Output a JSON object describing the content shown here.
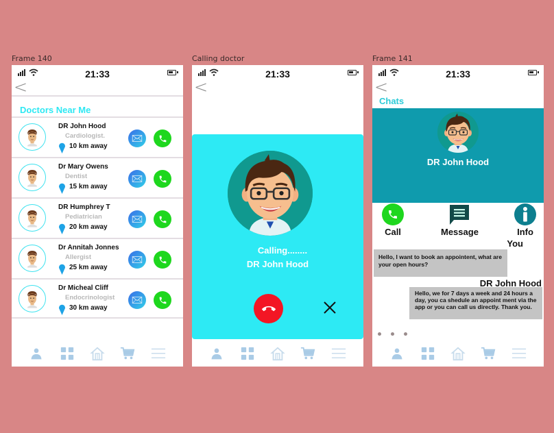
{
  "status_bar": {
    "time": "21:33"
  },
  "colors": {
    "background": "#d88686",
    "accent_cyan": "#2ee8f3",
    "call_green": "#1ed71e",
    "hangup_red": "#f31624",
    "chat_header_teal": "#0f9bad",
    "nav_icon_blue": "#a9cbe6"
  },
  "frames": [
    {
      "label": "Frame 140",
      "title": "Doctors Near Me",
      "doctors": [
        {
          "name": "DR John Hood",
          "specialty": "Cardiologist.",
          "distance": "10 km away"
        },
        {
          "name": "Dr Mary Owens",
          "specialty": "Dentist",
          "distance": "15 km away"
        },
        {
          "name": "DR Humphrey  T",
          "specialty": "Pediatrician",
          "distance": "20 km away"
        },
        {
          "name": "Dr Annitah Jonnes",
          "specialty": "Allergist",
          "distance": "25 km away"
        },
        {
          "name": "Dr Micheal  Cliff",
          "specialty": "Endocrinologist",
          "distance": "30  km away"
        }
      ]
    },
    {
      "label": "Calling doctor",
      "calling_text": "Calling........",
      "doctor_name": "DR John Hood"
    },
    {
      "label": "Frame 141",
      "title": "Chats",
      "doctor_name": "DR John Hood",
      "actions": [
        {
          "label": "Call",
          "icon": "phone-icon"
        },
        {
          "label": "Message",
          "icon": "message-icon"
        },
        {
          "label": "Info",
          "icon": "info-icon"
        }
      ],
      "messages": [
        {
          "sender": "You",
          "text": "Hello, I want to book an appointent, what are your open hours?"
        },
        {
          "sender": "DR John Hood",
          "text": "Hello, we for 7 days a week and 24 hours a day, you ca shedule an appoint ment via the app or you can call us directly. Thank you."
        }
      ]
    }
  ],
  "bottom_nav": [
    {
      "icon": "user-icon"
    },
    {
      "icon": "grid-icon"
    },
    {
      "icon": "home-icon"
    },
    {
      "icon": "cart-icon"
    },
    {
      "icon": "menu-icon"
    }
  ]
}
